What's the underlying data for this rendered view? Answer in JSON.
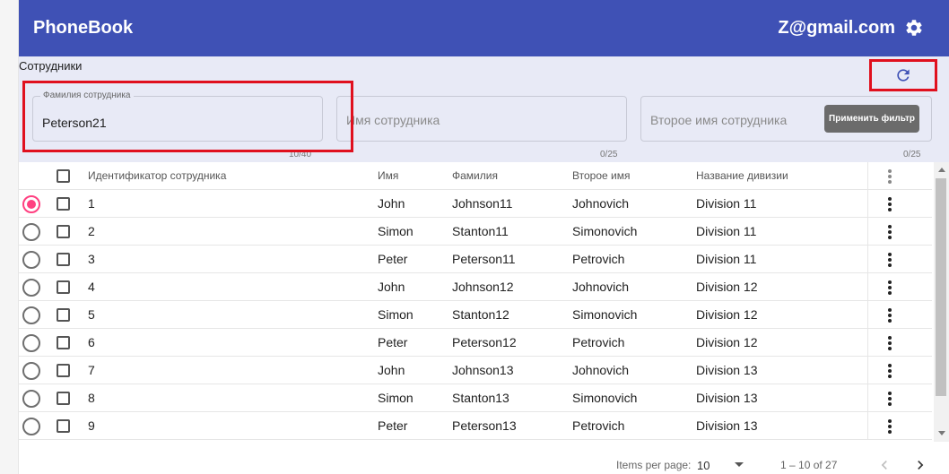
{
  "toolbar": {
    "title": "PhoneBook",
    "user_email": "Z@gmail.com",
    "settings_icon": "gear-icon",
    "color": "#3f51b5"
  },
  "filter": {
    "title": "Сотрудники",
    "refresh_icon": "refresh-icon",
    "last_name": {
      "label": "Фамилия сотрудника",
      "value": "Peterson21",
      "counter": "10/40"
    },
    "first_name": {
      "placeholder": "Имя сотрудника",
      "counter": "0/25"
    },
    "middle_name": {
      "placeholder": "Второе имя сотрудника",
      "counter": "0/25"
    },
    "apply_label": "Применить фильтр"
  },
  "table": {
    "columns": [
      "Идентификатор сотрудника",
      "Имя",
      "Фамилия",
      "Второе имя",
      "Название дивизии"
    ],
    "selected_row": 0,
    "rows": [
      {
        "id": "1",
        "first": "John",
        "last": "Johnson11",
        "middle": "Johnovich",
        "division": "Division 11"
      },
      {
        "id": "2",
        "first": "Simon",
        "last": "Stanton11",
        "middle": "Simonovich",
        "division": "Division 11"
      },
      {
        "id": "3",
        "first": "Peter",
        "last": "Peterson11",
        "middle": "Petrovich",
        "division": "Division 11"
      },
      {
        "id": "4",
        "first": "John",
        "last": "Johnson12",
        "middle": "Johnovich",
        "division": "Division 12"
      },
      {
        "id": "5",
        "first": "Simon",
        "last": "Stanton12",
        "middle": "Simonovich",
        "division": "Division 12"
      },
      {
        "id": "6",
        "first": "Peter",
        "last": "Peterson12",
        "middle": "Petrovich",
        "division": "Division 12"
      },
      {
        "id": "7",
        "first": "John",
        "last": "Johnson13",
        "middle": "Johnovich",
        "division": "Division 13"
      },
      {
        "id": "8",
        "first": "Simon",
        "last": "Stanton13",
        "middle": "Simonovich",
        "division": "Division 13"
      },
      {
        "id": "9",
        "first": "Peter",
        "last": "Peterson13",
        "middle": "Petrovich",
        "division": "Division 13"
      }
    ]
  },
  "paginator": {
    "items_label": "Items per page:",
    "page_size": "10",
    "range": "1 – 10 of 27"
  },
  "colors": {
    "accent": "#ff4081",
    "highlight": "#e0101e",
    "panel": "#e8eaf6"
  }
}
